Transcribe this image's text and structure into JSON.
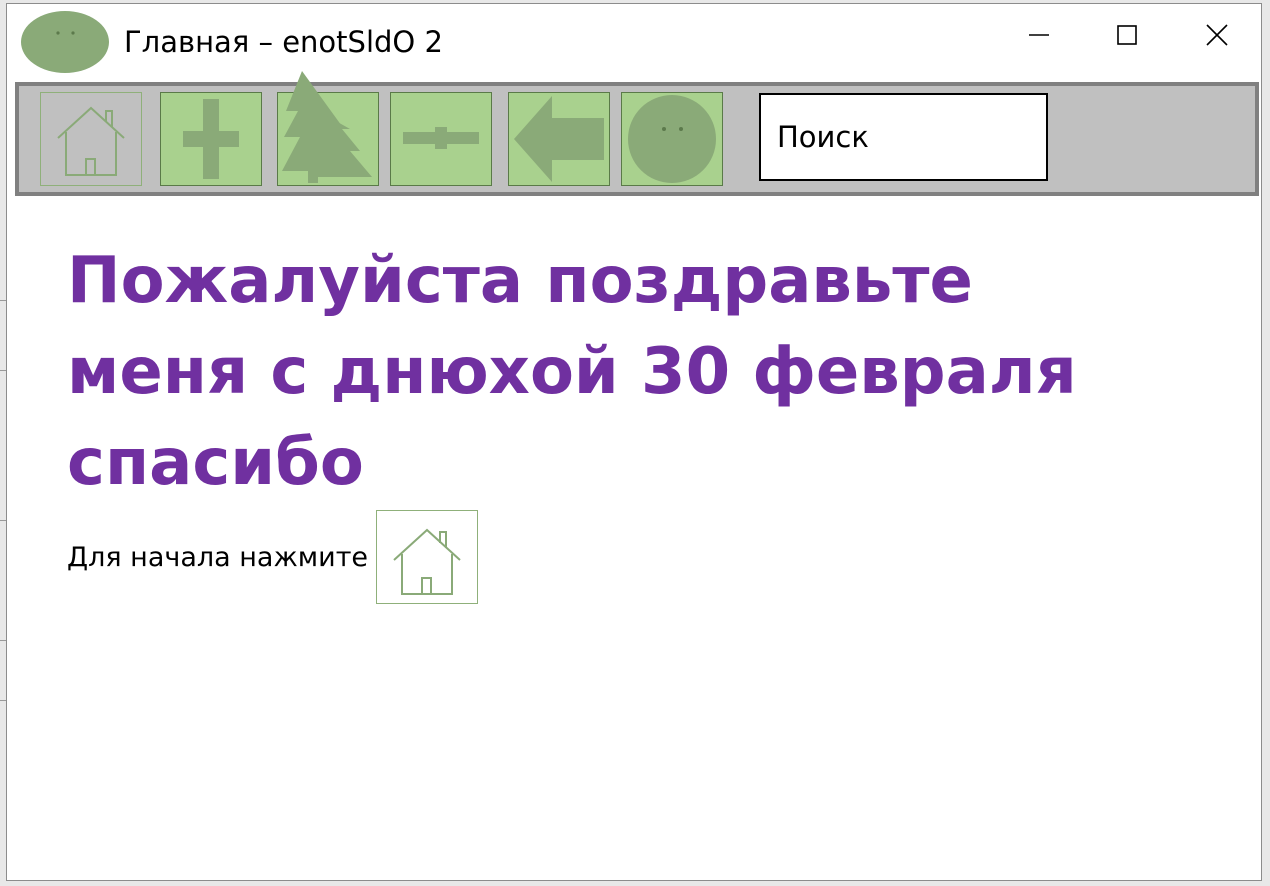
{
  "window": {
    "title": "Главная – enotSldO 2"
  },
  "toolbar": {
    "buttons": [
      {
        "name": "home",
        "icon": "home-icon"
      },
      {
        "name": "add",
        "icon": "plus-icon"
      },
      {
        "name": "tree",
        "icon": "tree-icon"
      },
      {
        "name": "subtract",
        "icon": "minus-icon"
      },
      {
        "name": "back",
        "icon": "arrow-left-icon"
      },
      {
        "name": "profile",
        "icon": "face-icon"
      }
    ],
    "search": {
      "value": "Поиск"
    }
  },
  "main": {
    "headline": "Пожалуйста поздравьте меня с днюхой 30 февраля спасибо",
    "start_prompt": "Для начала нажмите"
  },
  "colors": {
    "accent_green": "#a9d18e",
    "icon_green": "#8aaa78",
    "headline_purple": "#7030a0",
    "toolbar_bg": "#c0c0c0",
    "toolbar_border": "#808080"
  }
}
